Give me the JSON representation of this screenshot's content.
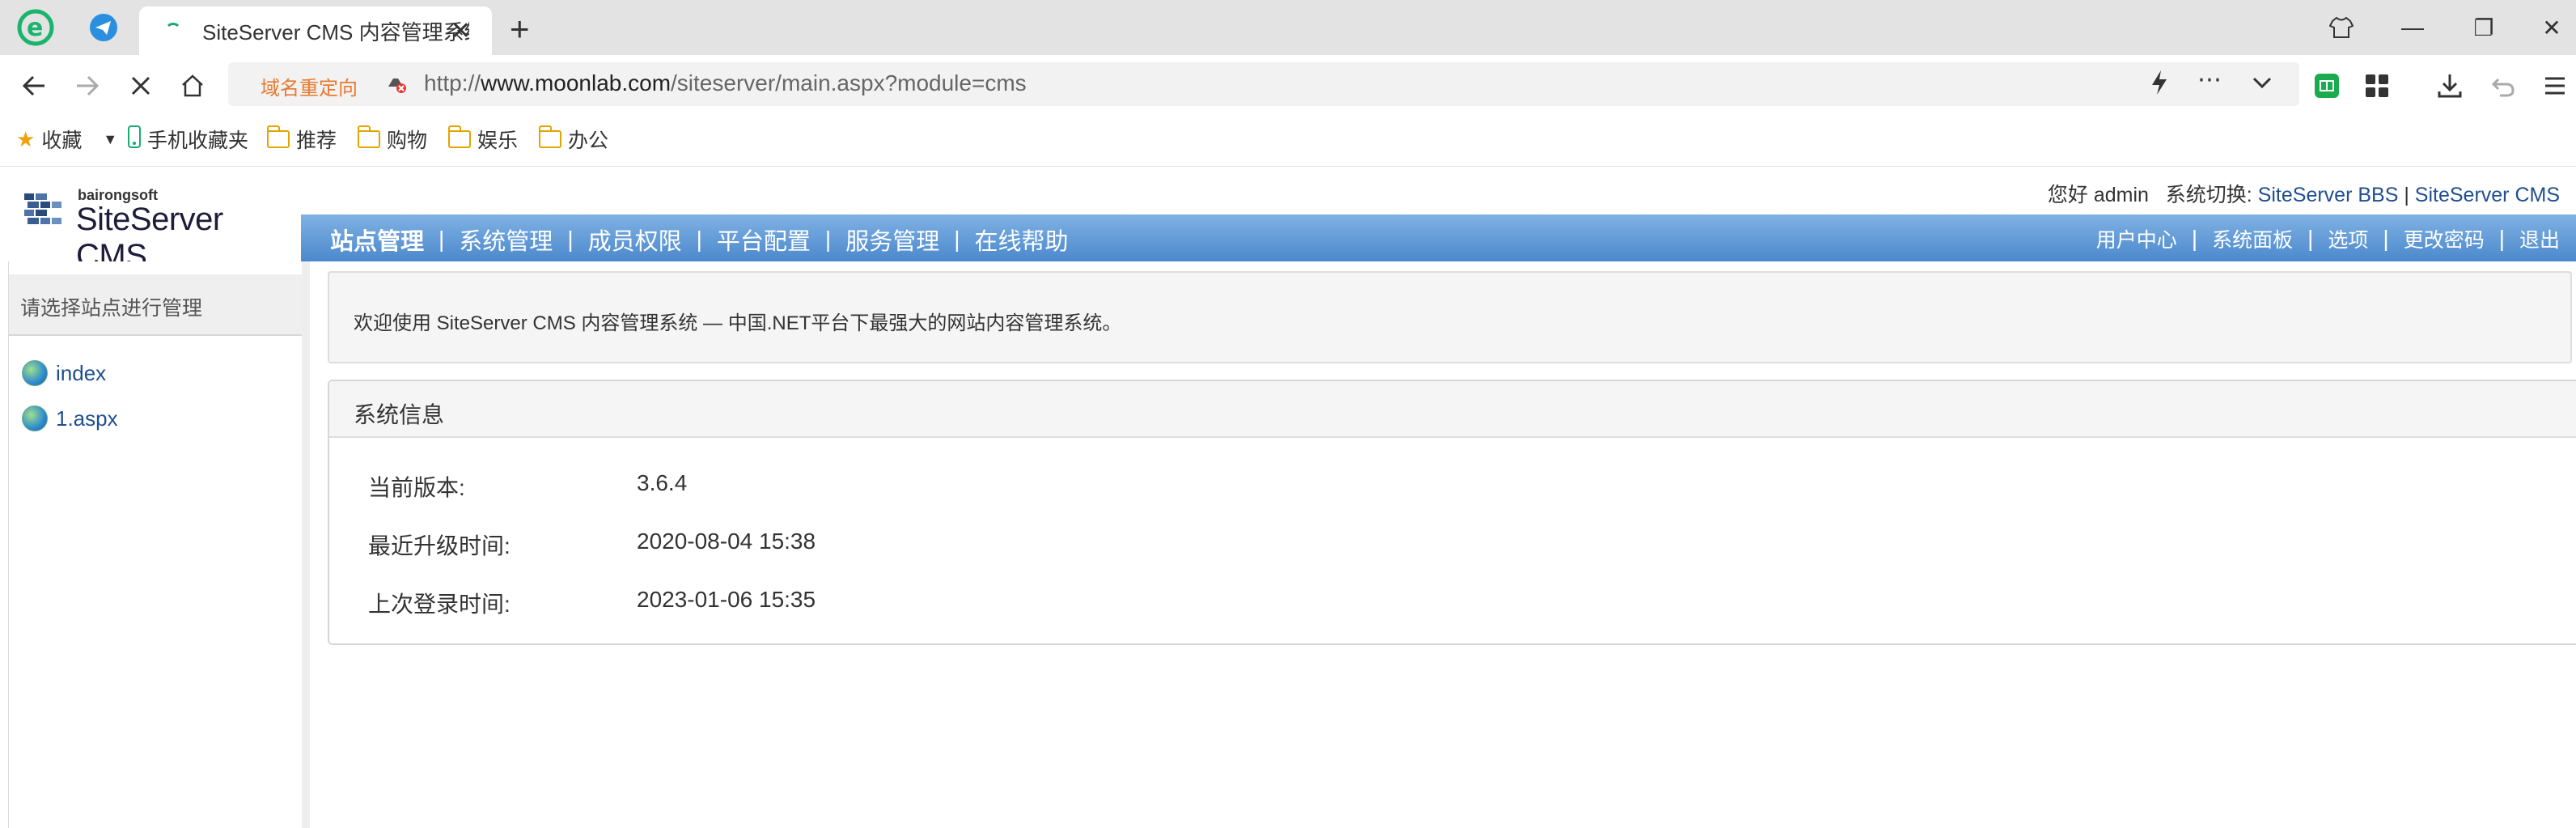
{
  "browser": {
    "tab_title": "SiteServer CMS 内容管理系统",
    "tab_close": "✕",
    "new_tab": "+",
    "window_controls": {
      "restore_icon": "⧉",
      "minimize": "—",
      "maximize": "❐",
      "close": "✕"
    },
    "redirect_tag": "域名重定向",
    "url_prefix": "http://",
    "url_domain": "www.moonlab.com",
    "url_path": "/siteserver/main.aspx?module=cms",
    "bookmarks": {
      "favorites": "收藏",
      "mobile": "手机收藏夹",
      "folders": [
        "推荐",
        "购物",
        "娱乐",
        "办公"
      ]
    }
  },
  "header": {
    "logo_small": "bairongsoft",
    "logo_big": "SiteServer CMS",
    "greeting": "您好 admin",
    "switch_label": "系统切换:",
    "switch_bbs": "SiteServer BBS",
    "switch_sep": "|",
    "switch_cms": "SiteServer CMS"
  },
  "menu": {
    "left": [
      "站点管理",
      "系统管理",
      "成员权限",
      "平台配置",
      "服务管理",
      "在线帮助"
    ],
    "right": [
      "用户中心",
      "系统面板",
      "选项",
      "更改密码",
      "退出"
    ],
    "separator": "|"
  },
  "sidebar": {
    "heading": "请选择站点进行管理",
    "sites": [
      "index",
      "1.aspx"
    ]
  },
  "main": {
    "notice": "欢迎使用 SiteServer CMS 内容管理系统 — 中国.NET平台下最强大的网站内容管理系统。",
    "panel_title": "系统信息",
    "rows": [
      {
        "label": "当前版本:",
        "value": "3.6.4"
      },
      {
        "label": "最近升级时间:",
        "value": "2020-08-04 15:38"
      },
      {
        "label": "上次登录时间:",
        "value": "2023-01-06 15:35"
      }
    ]
  },
  "colors": {
    "menubar_top": "#80b2e4",
    "menubar_bottom": "#4b88cc",
    "link": "#1f4e91",
    "redirect": "#e8792f"
  }
}
